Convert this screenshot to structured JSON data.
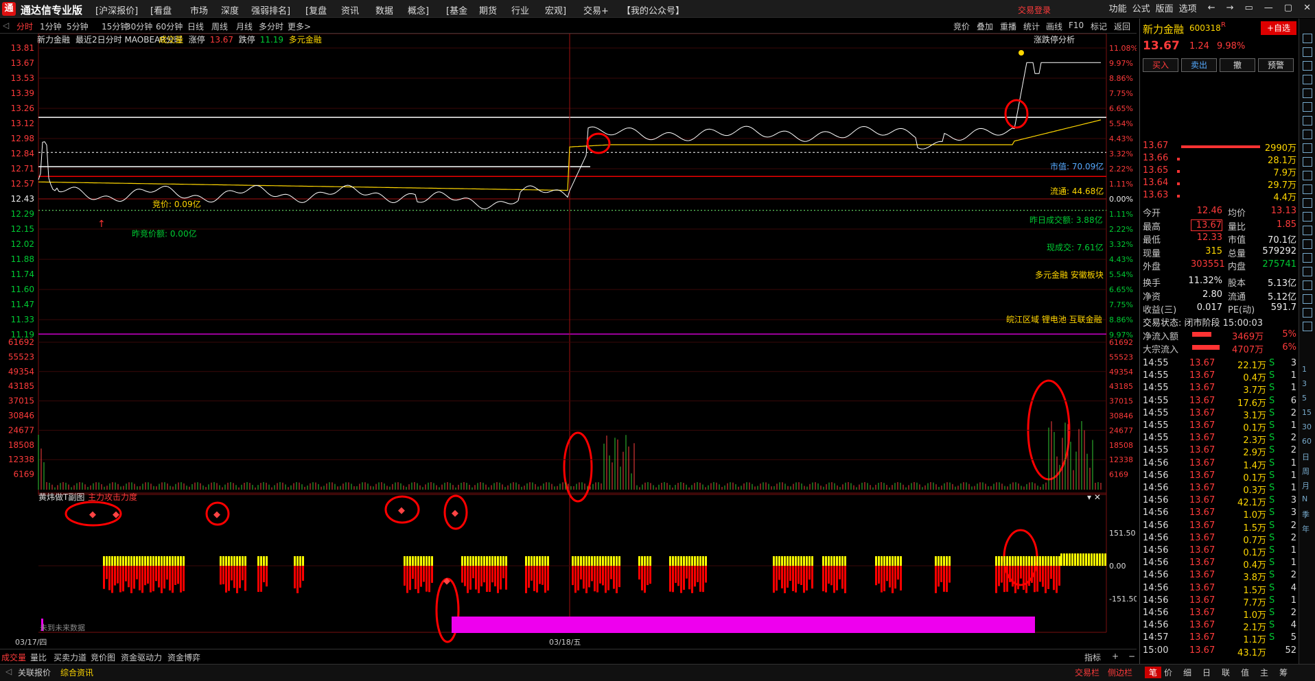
{
  "app": {
    "title": "通达信专业版",
    "logo": "通",
    "menus": [
      "[沪深报价]",
      "[看盘",
      "市场",
      "深度",
      "强弱排名]",
      "[复盘",
      "资讯",
      "数据",
      "概念]",
      "[基金",
      "期货",
      "行业",
      "宏观]",
      "交易+",
      "【我的公众号】"
    ],
    "login": "交易登录",
    "right_menus": [
      "功能",
      "公式",
      "版面",
      "选项"
    ]
  },
  "toolbar": {
    "periods": [
      "分时",
      "1分钟",
      "5分钟",
      "15分钟",
      "30分钟",
      "60分钟",
      "日线",
      "周线",
      "月线",
      "多分时",
      "更多>"
    ],
    "right": [
      "竞价",
      "叠加",
      "重播",
      "统计",
      "画线",
      "F10",
      "标记",
      "返回"
    ]
  },
  "header": {
    "name": "新力金融",
    "text": "最近2日分时 MAOBEAR分时",
    "vol": "成交量",
    "zt": "涨停",
    "zt_v": "13.67",
    "dt": "跌停",
    "dt_v": "11.19",
    "tag": "多元金融",
    "zdt": "涨跌停分析"
  },
  "price_axis": [
    "13.81",
    "13.67",
    "13.53",
    "13.39",
    "13.26",
    "13.12",
    "12.98",
    "12.84",
    "12.71",
    "12.57",
    "12.43",
    "12.29",
    "12.15",
    "12.02",
    "11.88",
    "11.74",
    "11.60",
    "11.47",
    "11.33",
    "11.19"
  ],
  "pct_axis": [
    "11.08%",
    "9.97%",
    "8.86%",
    "7.75%",
    "6.65%",
    "5.54%",
    "4.43%",
    "3.32%",
    "2.22%",
    "1.11%",
    "0.00%",
    "1.11%",
    "2.22%",
    "3.32%",
    "4.43%",
    "5.54%",
    "6.65%",
    "7.75%",
    "8.86%",
    "9.97%"
  ],
  "vol_axis": [
    "61692",
    "55523",
    "49354",
    "43185",
    "37015",
    "30846",
    "24677",
    "18508",
    "12338",
    "6169"
  ],
  "ind_axis": [
    "151.50",
    "0.00",
    "-151.50"
  ],
  "labels": {
    "jj": "竞价: 0.09亿",
    "zjj": "昨竞价额: 0.00亿",
    "sz": "市值: 70.09亿",
    "lt": "流通: 44.68亿",
    "zrcj": "昨日成交额: 3.88亿",
    "xcj": "现成交: 7.61亿",
    "bk1": "多元金融 安徽板块",
    "bk2": "皖江区域 锂电池 互联金融",
    "ind_title": "黄炜做T副图",
    "ind_sub": "主力攻击力度",
    "future": "未到未来数据",
    "d1": "03/17/四",
    "d2": "03/18/五"
  },
  "status": {
    "tabs": [
      "成交量",
      "量比",
      "买卖力道",
      "竞价图",
      "资金驱动力",
      "资金博弈"
    ],
    "right": "指标"
  },
  "bottom": {
    "left": [
      "关联报价",
      "综合资讯"
    ],
    "right": [
      "交易栏",
      "侧边栏"
    ],
    "rt": [
      "笔",
      "价",
      "细",
      "日",
      "联",
      "值",
      "主",
      "筹"
    ]
  },
  "quote": {
    "name": "新力金融",
    "code": "600318",
    "mark": "R",
    "add": "+自选",
    "price": "13.67",
    "chg": "1.24",
    "pct": "9.98%",
    "btns": [
      "买入",
      "卖出",
      "撤",
      "预警"
    ],
    "asks": [
      {
        "p": "13.67",
        "v": "2990万"
      },
      {
        "p": "13.66",
        "v": "28.1万"
      },
      {
        "p": "13.65",
        "v": "7.9万"
      },
      {
        "p": "13.64",
        "v": "29.7万"
      },
      {
        "p": "13.63",
        "v": "4.4万"
      }
    ],
    "stats": [
      [
        "今开",
        "12.46",
        "均价",
        "13.13"
      ],
      [
        "最高",
        "13.67",
        "量比",
        "1.85"
      ],
      [
        "最低",
        "12.33",
        "市值",
        "70.1亿"
      ],
      [
        "现量",
        "315",
        "总量",
        "579292"
      ],
      [
        "外盘",
        "303551",
        "内盘",
        "275741"
      ]
    ],
    "stats2": [
      [
        "换手",
        "11.32%",
        "股本",
        "5.13亿"
      ],
      [
        "净资",
        "2.80",
        "流通",
        "5.12亿"
      ],
      [
        "收益(三)",
        "0.017",
        "PE(动)",
        "591.7"
      ]
    ],
    "state": "交易状态: 闭市阶段 15:00:03",
    "flow": [
      [
        "净流入额",
        "3469万",
        "5%"
      ],
      [
        "大宗流入",
        "4707万",
        "6%"
      ]
    ],
    "ticks": [
      [
        "14:55",
        "13.67",
        "22.1万",
        "S",
        "3"
      ],
      [
        "14:55",
        "13.67",
        "0.4万",
        "S",
        "1"
      ],
      [
        "14:55",
        "13.67",
        "3.7万",
        "S",
        "1"
      ],
      [
        "14:55",
        "13.67",
        "17.6万",
        "S",
        "6"
      ],
      [
        "14:55",
        "13.67",
        "3.1万",
        "S",
        "2"
      ],
      [
        "14:55",
        "13.67",
        "0.1万",
        "S",
        "1"
      ],
      [
        "14:55",
        "13.67",
        "2.3万",
        "S",
        "2"
      ],
      [
        "14:55",
        "13.67",
        "2.9万",
        "S",
        "2"
      ],
      [
        "14:56",
        "13.67",
        "1.4万",
        "S",
        "1"
      ],
      [
        "14:56",
        "13.67",
        "0.1万",
        "S",
        "1"
      ],
      [
        "14:56",
        "13.67",
        "0.3万",
        "S",
        "1"
      ],
      [
        "14:56",
        "13.67",
        "42.1万",
        "S",
        "3"
      ],
      [
        "14:56",
        "13.67",
        "1.0万",
        "S",
        "3"
      ],
      [
        "14:56",
        "13.67",
        "1.5万",
        "S",
        "2"
      ],
      [
        "14:56",
        "13.67",
        "0.7万",
        "S",
        "2"
      ],
      [
        "14:56",
        "13.67",
        "0.1万",
        "S",
        "1"
      ],
      [
        "14:56",
        "13.67",
        "0.4万",
        "S",
        "1"
      ],
      [
        "14:56",
        "13.67",
        "3.8万",
        "S",
        "2"
      ],
      [
        "14:56",
        "13.67",
        "1.5万",
        "S",
        "4"
      ],
      [
        "14:56",
        "13.67",
        "7.7万",
        "S",
        "1"
      ],
      [
        "14:56",
        "13.67",
        "1.0万",
        "S",
        "2"
      ],
      [
        "14:56",
        "13.67",
        "2.1万",
        "S",
        "4"
      ],
      [
        "14:57",
        "13.67",
        "1.1万",
        "S",
        "5"
      ],
      [
        "15:00",
        "13.67",
        "43.1万",
        "",
        "52"
      ]
    ]
  },
  "side_icons": [
    "1",
    "3",
    "5",
    "15",
    "30",
    "60",
    "日",
    "周",
    "月",
    "N",
    "季",
    "年"
  ]
}
